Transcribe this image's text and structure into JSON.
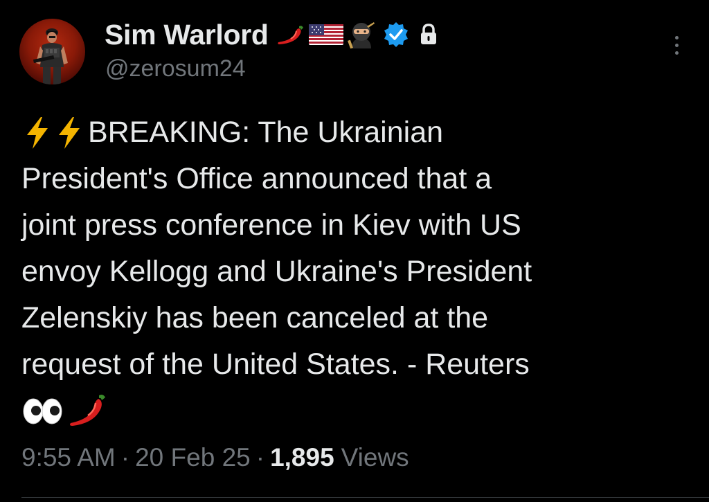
{
  "author": {
    "display_name": "Sim Warlord",
    "handle": "@zerosum24",
    "name_emojis": [
      "chili-pepper",
      "us-flag",
      "ninja",
      "verified-badge",
      "lock"
    ]
  },
  "tweet": {
    "lines": [
      "BREAKING: The Ukrainian",
      "President's Office announced that a",
      "joint press conference in Kiev with US",
      "envoy Kellogg and Ukraine's President",
      "Zelenskiy has been canceled at the",
      "request of the United States. - Reuters"
    ],
    "leading_emojis": [
      "lightning",
      "lightning"
    ],
    "trailing_emojis": [
      "eyes",
      "chili-pepper"
    ]
  },
  "meta": {
    "time": "9:55 AM",
    "separator": "·",
    "date": "20 Feb 25",
    "views_count": "1,895",
    "views_label": "Views"
  },
  "colors": {
    "background": "#000000",
    "text": "#e7e9ea",
    "secondary": "#71767b",
    "verified": "#1d9bf0",
    "lightning": "#f4b400",
    "chili": "#d81e1e"
  }
}
